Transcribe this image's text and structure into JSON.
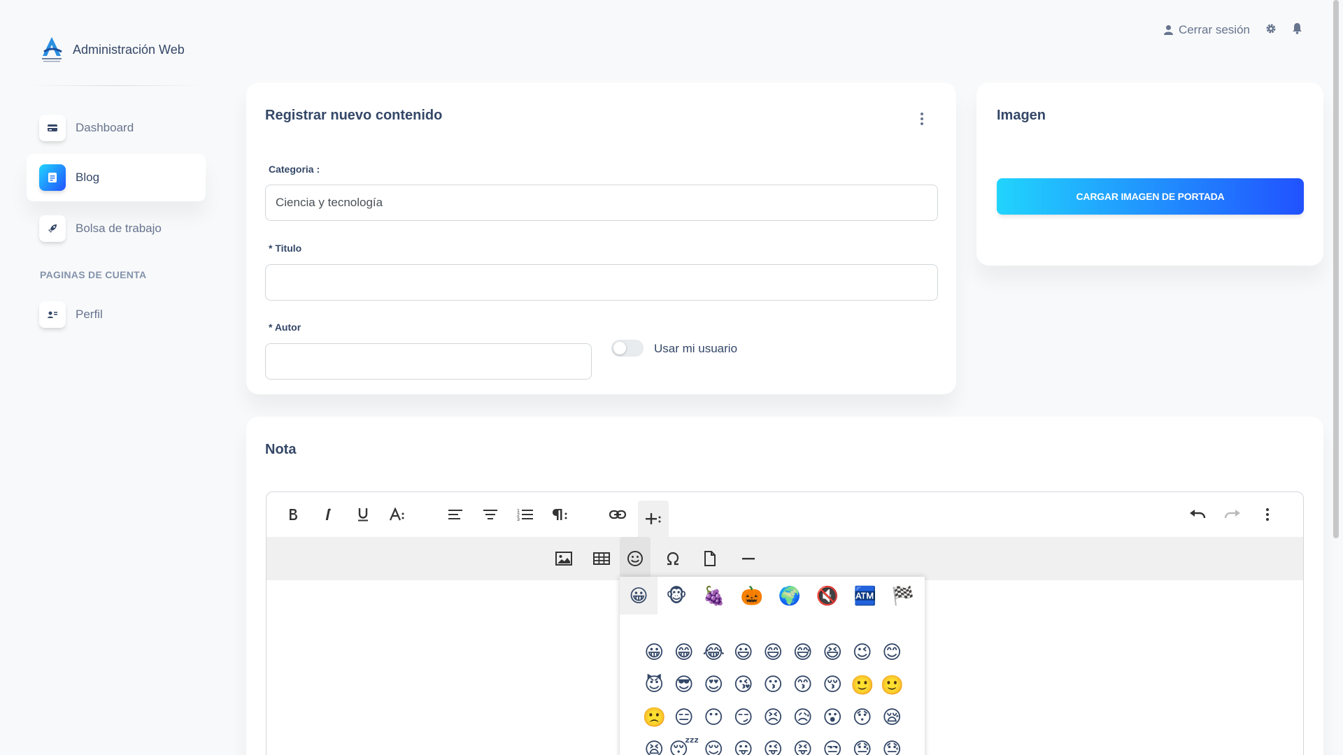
{
  "brand": {
    "name": "Administración Web"
  },
  "sidebar": {
    "items": [
      {
        "label": "Dashboard",
        "icon": "card-icon"
      },
      {
        "label": "Blog",
        "icon": "document-icon",
        "active": true
      },
      {
        "label": "Bolsa de trabajo",
        "icon": "rocket-icon"
      }
    ],
    "section_title": "PAGINAS DE CUENTA",
    "account_items": [
      {
        "label": "Perfil",
        "icon": "user-icon"
      }
    ]
  },
  "topbar": {
    "logout_label": "Cerrar sesión",
    "settings_icon": "gear-icon",
    "notifications_icon": "bell-icon"
  },
  "form_card": {
    "title": "Registrar nuevo contenido",
    "category_label": "Categoria :",
    "category_value": "Ciencia y tecnología",
    "title_label": "* Titulo",
    "title_value": "",
    "author_label": "* Autor",
    "author_value": "",
    "use_user_label": "Usar mi usuario",
    "use_user_enabled": false
  },
  "image_card": {
    "title": "Imagen",
    "upload_button": "CARGAR IMAGEN DE PORTADA"
  },
  "note_card": {
    "title": "Nota"
  },
  "editor": {
    "toolbar_primary": [
      "bold-icon",
      "italic-icon",
      "underline-icon",
      "text-size-icon",
      "align-left-icon",
      "align-center-icon",
      "ordered-list-icon",
      "paragraph-icon",
      "link-icon",
      "more-insert-icon",
      "undo-icon",
      "redo-icon",
      "more-options-icon"
    ],
    "toolbar_insert": [
      "image-icon",
      "table-icon",
      "emoji-icon",
      "special-char-icon",
      "file-icon",
      "horizontal-line-icon"
    ],
    "emoji_tabs": [
      "😀",
      "🐵",
      "🍇",
      "🎃",
      "🌍",
      "🔇",
      "🏧",
      "🏁"
    ],
    "emojis": [
      "😀",
      "😁",
      "😂",
      "😃",
      "😄",
      "😅",
      "😆",
      "😉",
      "😊",
      "😈",
      "😎",
      "😍",
      "😘",
      "😗",
      "😙",
      "😚",
      "🙂",
      "🙂",
      "🙁",
      "😑",
      "😶",
      "😏",
      "😣",
      "😥",
      "😮",
      "😯",
      "😪",
      "😫",
      "😴",
      "😌",
      "😛",
      "😜",
      "😝",
      "😒",
      "😓",
      "😓"
    ]
  },
  "colors": {
    "accent_start": "#21d4fd",
    "accent_end": "#2152ff",
    "text": "#344767",
    "muted": "#67748e"
  }
}
